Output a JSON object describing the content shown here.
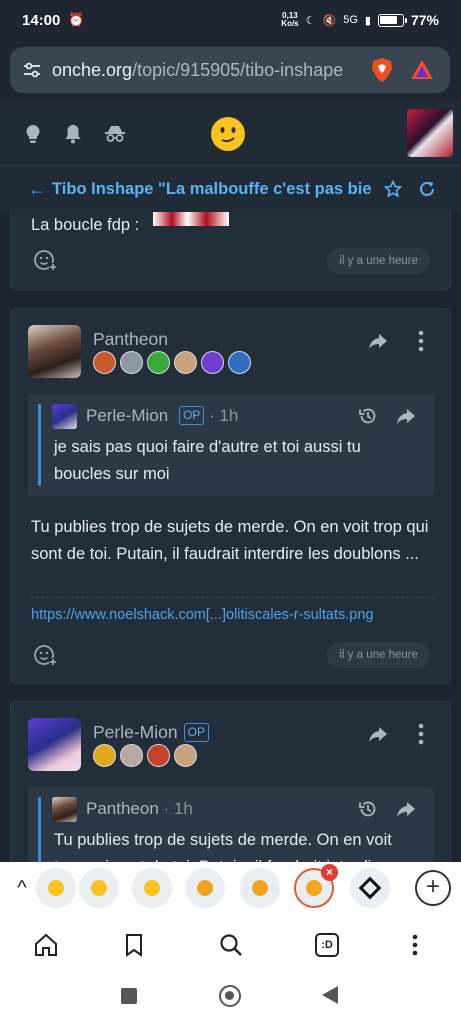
{
  "status_bar": {
    "time": "14:00",
    "net_speed_value": "0,13",
    "net_speed_unit": "Ko/s",
    "network": "5G",
    "battery_percent": "77%",
    "battery_level": 0.77
  },
  "browser": {
    "url_domain": "onche.org",
    "url_path": "/topic/915905/tibo-inshape"
  },
  "topic": {
    "title": "Tibo Inshape \"La malbouffe c'est pas bie"
  },
  "posts": [
    {
      "text": "La boucle fdp :",
      "time": "il y a une heure"
    },
    {
      "author": "Pantheon",
      "quote": {
        "author": "Perle-Mion",
        "op": "OP",
        "time": "· 1h",
        "text": "je sais pas quoi faire d'autre et toi aussi tu boucles sur moi"
      },
      "text": "Tu publies trop de sujets de merde. On en voit trop qui sont de toi. Putain, il faudrait interdire les doublons ...",
      "link": "https://www.noelshack.com[...]olitiscales-r-sultats.png",
      "time": "il y a une heure"
    },
    {
      "author": "Perle-Mion",
      "op": "OP",
      "quote": {
        "author": "Pantheon",
        "time": "· 1h",
        "text": "Tu publies trop de sujets de merde. On en voit trop qui sont de toi. Putain, il faudrait interdire"
      }
    }
  ],
  "bottom_nav": {
    "tabs_label": ":D"
  },
  "colors": {
    "accent": "#5ab2f2",
    "background": "#1b2430",
    "card": "#232e3b"
  }
}
